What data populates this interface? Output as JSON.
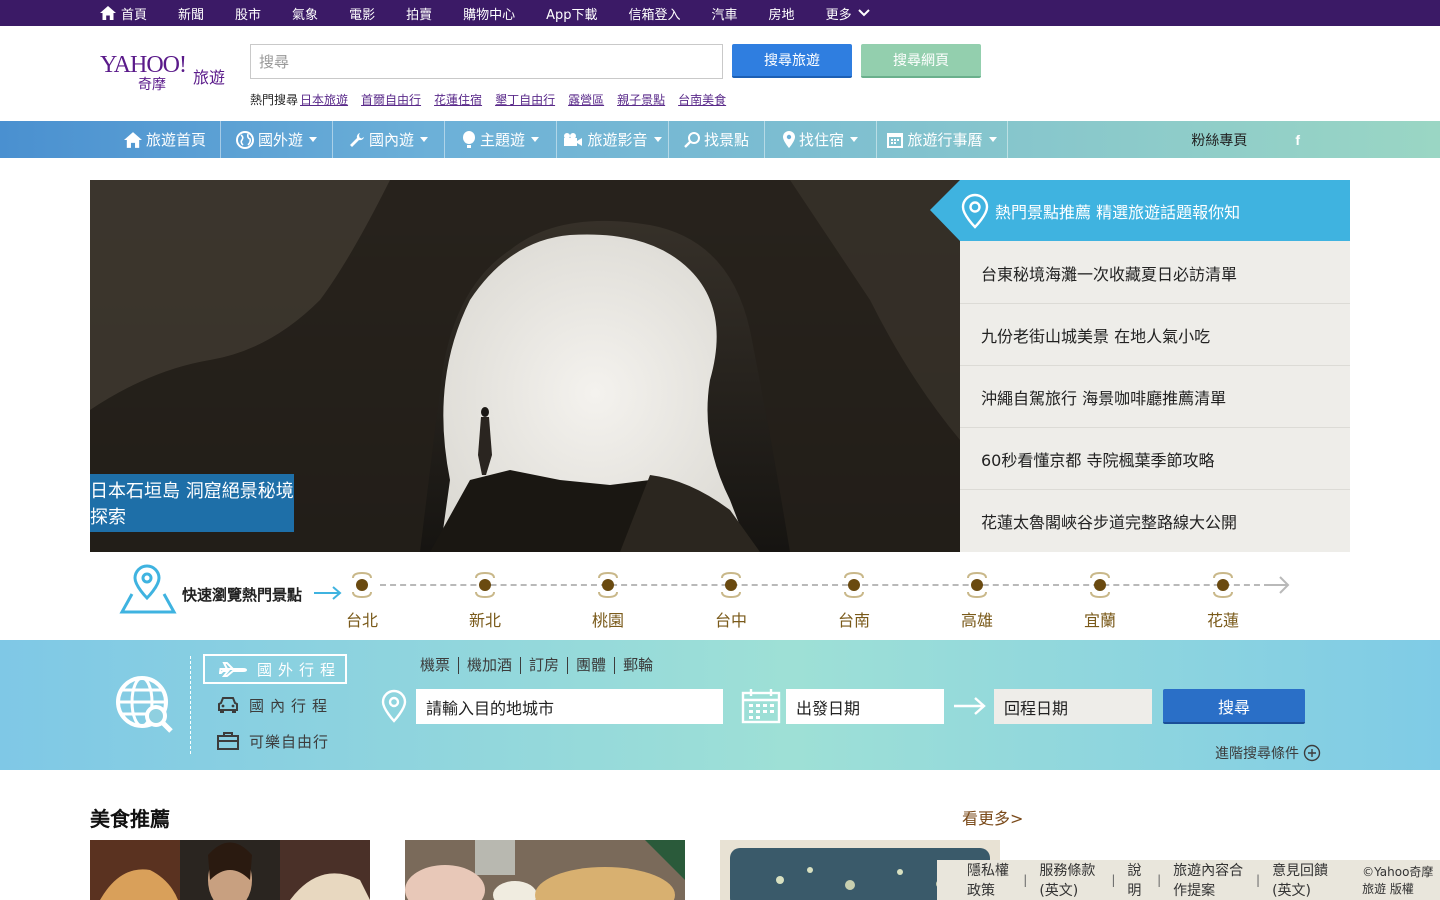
{
  "topbar": {
    "items": [
      "首頁",
      "新聞",
      "股市",
      "氣象",
      "電影",
      "拍賣",
      "購物中心",
      "App下載",
      "信箱登入",
      "汽車",
      "房地",
      "更多"
    ]
  },
  "header": {
    "logo_brand": "YAHOO!",
    "logo_sub": "奇摩",
    "logo_section": "旅遊",
    "search_placeholder": "搜尋",
    "search_travel_label": "搜尋旅遊",
    "search_web_label": "搜尋網頁",
    "hot_label": "熱門搜尋",
    "hot_links": [
      "日本旅遊",
      "首爾自由行",
      "花蓮住宿",
      "墾丁自由行",
      "露營區",
      "親子景點",
      "台南美食"
    ]
  },
  "nav": {
    "items": [
      "旅遊首頁",
      "國外遊",
      "國內遊",
      "主題遊",
      "旅遊影音",
      "找景點",
      "找住宿",
      "旅遊行事曆"
    ],
    "fan_label": "粉絲專頁",
    "fb_label": "f"
  },
  "hero": {
    "caption": "日本石垣島 洞窟絕景秘境探索"
  },
  "sidebox": {
    "header": "熱門景點推薦 精選旅遊話題報你知",
    "items": [
      "台東秘境海灘一次收藏夏日必訪清單",
      "九份老街山城美景 在地人氣小吃",
      "沖繩自駕旅行 海景咖啡廳推薦清單",
      "60秒看懂京都 寺院楓葉季節攻略",
      "花蓮太魯閣峽谷步道完整路線大公開"
    ]
  },
  "timeline": {
    "title": "快速瀏覽熱門景點",
    "labels": [
      "台北",
      "新北",
      "桃園",
      "台中",
      "台南",
      "高雄",
      "宜蘭",
      "花蓮"
    ]
  },
  "booking": {
    "tabs": [
      "國外行程",
      "國內行程",
      "可樂自由行"
    ],
    "types": [
      "機票",
      "機加酒",
      "訂房",
      "團體",
      "郵輪"
    ],
    "destination_value": "請輸入目的地城市",
    "depart_value": "出發日期",
    "return_value": "回程日期",
    "go_label": "搜尋",
    "advanced_label": "進階搜尋條件"
  },
  "section": {
    "title": "美食推薦",
    "more_label": "看更多>"
  },
  "footer": {
    "links": [
      "隱私權政策",
      "服務條款(英文)",
      "說明",
      "旅遊內容合作提案",
      "意見回饋(英文)"
    ],
    "copyright": "©Yahoo奇摩旅遊 版權"
  },
  "colors": {
    "topbar": "#3b1a66",
    "nav_start": "#4a90d0",
    "nav_end": "#9ad6c4",
    "side_header": "#3fb3e0",
    "hero_caption": "#1e6fa8",
    "button_primary": "#2f7ee0",
    "button_secondary": "#93cfae"
  }
}
